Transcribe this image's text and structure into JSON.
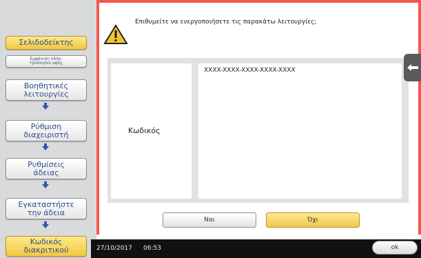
{
  "left_nav": {
    "bookmark": "Σελιδοδείκτης",
    "display_tip": "Εμφάνιση πλήκ-\nτρολογίου αφής",
    "utilities": "Βοηθητικές\nλειτουργίες",
    "admin_settings": "Ρύθμιση\nδιαχειριστή",
    "license_settings": "Ρυθμίσεις\nάδειας",
    "install_license": "Εγκαταστήστε\nτην άδεια",
    "privilege_code": "Κωδικός\nδιακριτικού"
  },
  "dialog": {
    "prompt": "Επιθυμείτε να ενεργοποιήσετε τις παρακάτω λειτουργίες;",
    "code_label": "Κωδικός",
    "code_value": "XXXX-XXXX-XXXX-XXXX-XXXX",
    "yes_label": "Ναι",
    "no_label": "Όχι"
  },
  "status_bar": {
    "date": "27/10/2017",
    "time": "06:53",
    "ok_label": "ok"
  },
  "colors": {
    "panel_border": "#f3584c",
    "yellow_button": "#f1c843",
    "nav_text": "#2b4f8a"
  }
}
